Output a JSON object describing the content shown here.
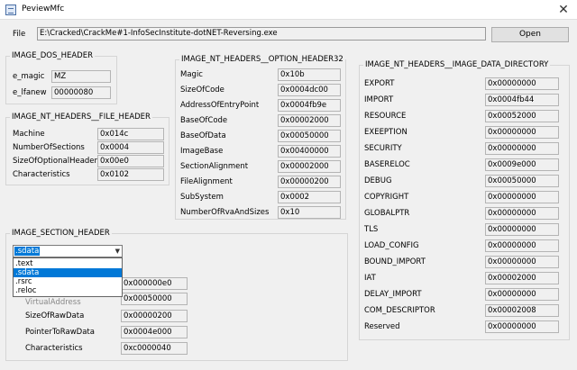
{
  "window": {
    "title": "PeviewMfc"
  },
  "file": {
    "label": "File",
    "path": "E:\\Cracked\\CrackMe#1-InfoSecInstitute-dotNET-Reversing.exe",
    "open_label": "Open"
  },
  "dos_header": {
    "title": "IMAGE_DOS_HEADER",
    "fields": [
      {
        "label": "e_magic",
        "value": "MZ"
      },
      {
        "label": "e_lfanew",
        "value": "00000080"
      }
    ]
  },
  "file_header": {
    "title": "IMAGE_NT_HEADERS__FILE_HEADER",
    "fields": [
      {
        "label": "Machine",
        "value": "0x014c"
      },
      {
        "label": "NumberOfSections",
        "value": "0x0004"
      },
      {
        "label": "SizeOfOptionalHeader",
        "value": "0x00e0"
      },
      {
        "label": "Characteristics",
        "value": "0x0102"
      }
    ]
  },
  "option_header": {
    "title": "IMAGE_NT_HEADERS__OPTION_HEADER32",
    "fields": [
      {
        "label": "Magic",
        "value": "0x10b"
      },
      {
        "label": "SizeOfCode",
        "value": "0x0004dc00"
      },
      {
        "label": "AddressOfEntryPoint",
        "value": "0x0004fb9e"
      },
      {
        "label": "BaseOfCode",
        "value": "0x00002000"
      },
      {
        "label": "BaseOfData",
        "value": "0x00050000"
      },
      {
        "label": "ImageBase",
        "value": "0x00400000"
      },
      {
        "label": "SectionAlignment",
        "value": "0x00002000"
      },
      {
        "label": "FileAlignment",
        "value": "0x00000200"
      },
      {
        "label": "SubSystem",
        "value": "0x0002"
      },
      {
        "label": "NumberOfRvaAndSizes",
        "value": "0x10"
      }
    ]
  },
  "data_directory": {
    "title": "IMAGE_NT_HEADERS__IMAGE_DATA_DIRECTORY",
    "fields": [
      {
        "label": "EXPORT",
        "value": "0x00000000"
      },
      {
        "label": "IMPORT",
        "value": "0x0004fb44"
      },
      {
        "label": "RESOURCE",
        "value": "0x00052000"
      },
      {
        "label": "EXEEPTION",
        "value": "0x00000000"
      },
      {
        "label": "SECURITY",
        "value": "0x00000000"
      },
      {
        "label": "BASERELOC",
        "value": "0x0009e000"
      },
      {
        "label": "DEBUG",
        "value": "0x00050000"
      },
      {
        "label": "COPYRIGHT",
        "value": "0x00000000"
      },
      {
        "label": "GLOBALPTR",
        "value": "0x00000000"
      },
      {
        "label": "TLS",
        "value": "0x00000000"
      },
      {
        "label": "LOAD_CONFIG",
        "value": "0x00000000"
      },
      {
        "label": "BOUND_IMPORT",
        "value": "0x00000000"
      },
      {
        "label": "IAT",
        "value": "0x00002000"
      },
      {
        "label": "DELAY_IMPORT",
        "value": "0x00000000"
      },
      {
        "label": "COM_DESCRIPTOR",
        "value": "0x00002008"
      },
      {
        "label": "Reserved",
        "value": "0x00000000"
      }
    ]
  },
  "section_header": {
    "title": "IMAGE_SECTION_HEADER",
    "selected": ".sdata",
    "options": [
      ".text",
      ".sdata",
      ".rsrc",
      ".reloc"
    ],
    "fields": [
      {
        "label": "",
        "value": "0x000000e0"
      },
      {
        "label": "VirtualAddress",
        "value": "0x00050000"
      },
      {
        "label": "SizeOfRawData",
        "value": "0x00000200"
      },
      {
        "label": "PointerToRawData",
        "value": "0x0004e000"
      },
      {
        "label": "Characteristics",
        "value": "0xc0000040"
      }
    ]
  }
}
